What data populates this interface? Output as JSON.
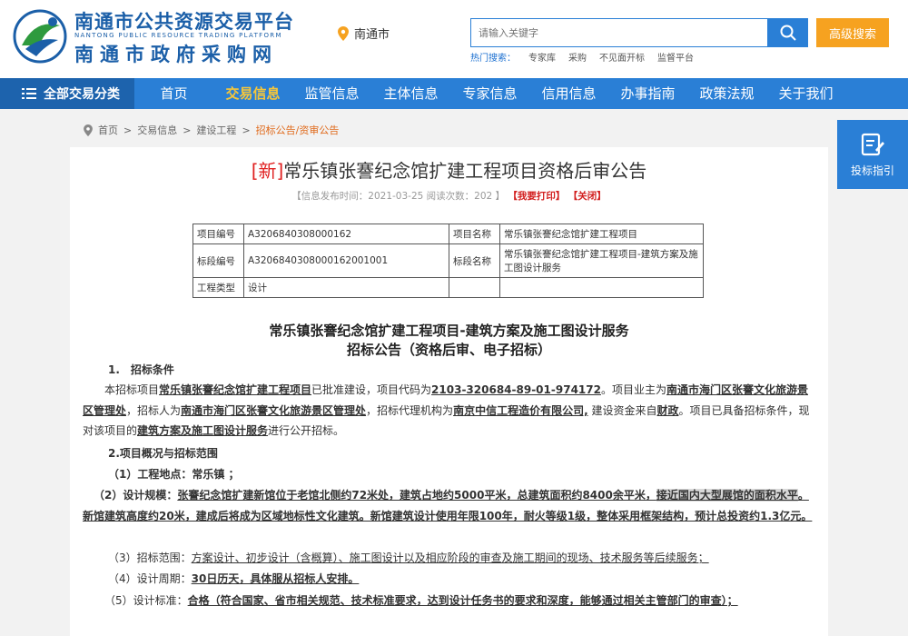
{
  "header": {
    "platform_name": "南通市公共资源交易平台",
    "platform_name_en": "NANTONG PUBLIC RESOURCE TRADING PLATFORM",
    "procurement_name": "南通市政府采购网",
    "city": "南通市",
    "search_placeholder": "请输入关键字",
    "advanced_search_label": "高级搜索",
    "hot_label": "热门搜索：",
    "hot_items": [
      "专家库",
      "采购",
      "不见面开标",
      "监督平台"
    ]
  },
  "nav": {
    "all_categories": "全部交易分类",
    "items": [
      "首页",
      "交易信息",
      "监管信息",
      "主体信息",
      "专家信息",
      "信用信息",
      "办事指南",
      "政策法规",
      "关于我们"
    ],
    "active_index": 1
  },
  "breadcrumb": {
    "items": [
      "首页",
      "交易信息",
      "建设工程"
    ],
    "current": "招标公告/资审公告",
    "sep": ">"
  },
  "article": {
    "new_tag": "[新]",
    "title": "常乐镇张謇纪念馆扩建工程项目资格后审公告",
    "meta_left": "【信息发布时间：2021-03-25 阅读次数：202 】",
    "print_label": "【我要打印】",
    "close_label": "【关闭】",
    "table": {
      "project_no_label": "项目编号",
      "project_no": "A3206840308000162",
      "project_name_label": "项目名称",
      "project_name": "常乐镇张謇纪念馆扩建工程项目",
      "section_no_label": "标段编号",
      "section_no": "A3206840308000162001001",
      "section_name_label": "标段名称",
      "section_name": "常乐镇张謇纪念馆扩建工程项目-建筑方案及施工图设计服务",
      "type_label": "工程类型",
      "type": "设计"
    },
    "doc_title": "常乐镇张謇纪念馆扩建工程项目-建筑方案及施工图设计服务",
    "doc_subtitle": "招标公告（资格后审、电子招标）",
    "section1_heading": "1.　招标条件",
    "p1": {
      "t1": "本招标项目",
      "project": "常乐镇张謇纪念馆扩建工程项目",
      "t2": "已批准建设，项目代码为",
      "code": "2103-320684-89-01-974172",
      "t3": "。项目业主为",
      "owner": "南通市海门区张謇文化旅游景区管理处",
      "t4": "，招标人为",
      "tenderer": "南通市海门区张謇文化旅游景区管理处",
      "t5": "，招标代理机构为",
      "agent": "南京中信工程造价有限公司,",
      "t6": " 建设资金来自",
      "fund": "财政",
      "t7": "。项目已具备招标条件，现对该项目的",
      "scope": "建筑方案及施工图设计服务",
      "t8": "进行公开招标。"
    },
    "section2_heading": "2.项目概况与招标范围",
    "s2_1": "（1）工程地点：常乐镇 ；",
    "s2_2_label": "（2）设计规模：",
    "s2_2_a": "张謇纪念馆扩建新馆位于老馆北侧约72米处，建筑占地约5000平米，总建筑面积约8400余平米，",
    "s2_2_b": "接近国内大型展馆的面积水平",
    "s2_2_c": "。新馆建筑高度约20米，建成后将成为区域地标性文化建筑。新馆建筑设计使用年限100年，耐火等级1级，整体采用框架结构，预计总投资约1.3亿元。",
    "s2_3_label": "（3）招标范围：",
    "s2_3": "方案设计、初步设计（含概算）、施工图设计以及相应阶段的审查及施工期间的现场、技术服务等后续服务；",
    "s2_4_label": "（4）设计周期：",
    "s2_4": "30日历天，具体服从招标人安排。",
    "s2_5_label": "（5）设计标准：",
    "s2_5": "合格（符合国家、省市相关规范、技术标准要求，达到设计任务书的要求和深度，能够通过相关主管部门的审查）；"
  },
  "float": {
    "guide_label": "投标指引"
  },
  "colors": {
    "brand_blue": "#2a7fd6",
    "nav_dark": "#1d63ad",
    "orange": "#f6a220",
    "active_nav": "#f6c63a",
    "red": "#e02020",
    "link_blue": "#1b6fd0"
  }
}
